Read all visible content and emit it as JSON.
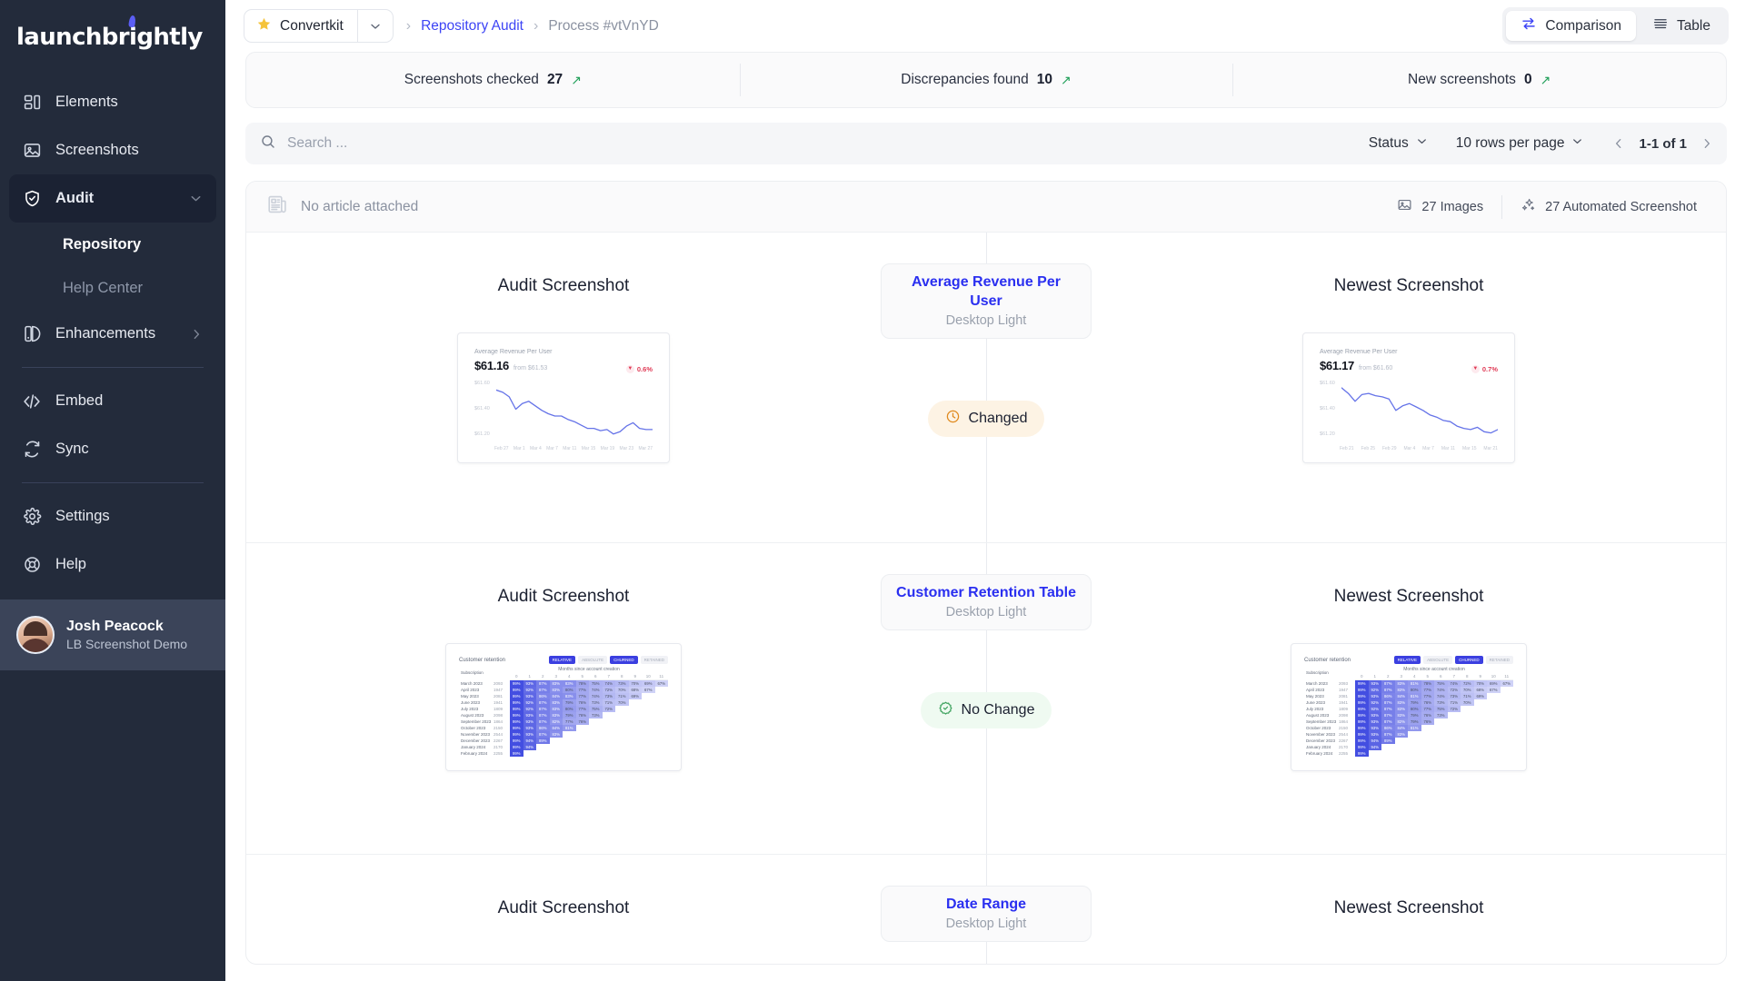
{
  "brand": {
    "logo_text": "launchbrightly",
    "accent": "#5b5ef4"
  },
  "sidebar": {
    "items": [
      {
        "label": "Elements",
        "icon": "elements-icon"
      },
      {
        "label": "Screenshots",
        "icon": "image-icon"
      },
      {
        "label": "Audit",
        "icon": "shield-check-icon",
        "active": true,
        "expanded": true
      },
      {
        "label": "Enhancements",
        "icon": "palette-icon"
      },
      {
        "label": "Embed",
        "icon": "code-icon"
      },
      {
        "label": "Sync",
        "icon": "refresh-icon"
      },
      {
        "label": "Settings",
        "icon": "gear-icon"
      }
    ],
    "sub_items": [
      {
        "label": "Repository",
        "active": true
      },
      {
        "label": "Help Center",
        "active": false
      }
    ],
    "help": {
      "label": "Help",
      "icon": "lifebuoy-icon"
    },
    "profile": {
      "name": "Josh Peacock",
      "org": "LB Screenshot Demo"
    }
  },
  "topbar": {
    "project": "Convertkit",
    "project_icon": "star-icon",
    "breadcrumb": [
      {
        "label": "Repository Audit",
        "type": "link"
      },
      {
        "label": "Process #vtVnYD",
        "type": "current"
      }
    ],
    "views": [
      {
        "label": "Comparison",
        "icon": "compare-arrows-icon",
        "active": true
      },
      {
        "label": "Table",
        "icon": "table-rows-icon",
        "active": false
      }
    ]
  },
  "stats": [
    {
      "label": "Screenshots checked",
      "value": "27",
      "trend": "↗"
    },
    {
      "label": "Discrepancies found",
      "value": "10",
      "trend": "↗"
    },
    {
      "label": "New screenshots",
      "value": "0",
      "trend": "↗"
    }
  ],
  "toolbar": {
    "search_placeholder": "Search ...",
    "search_value": "",
    "status_label": "Status",
    "rows_label": "10 rows per page",
    "page_label": "1-1 of 1"
  },
  "panel_head": {
    "article_text": "No article attached",
    "images_count": "27 Images",
    "automated_count": "27 Automated Screenshot"
  },
  "columns": {
    "left": "Audit Screenshot",
    "right": "Newest Screenshot"
  },
  "rows": [
    {
      "element": "Average Revenue Per User",
      "device": "Desktop Light",
      "status": "Changed",
      "status_type": "changed",
      "status_icon": "clock-icon"
    },
    {
      "element": "Customer Retention Table",
      "device": "Desktop Light",
      "status": "No Change",
      "status_type": "nochange",
      "status_icon": "check-badge-icon"
    },
    {
      "element": "Date Range",
      "device": "Desktop Light",
      "status": "",
      "status_type": "",
      "status_icon": ""
    }
  ],
  "chart_data": [
    {
      "type": "line",
      "id": "arpu-audit",
      "title": "Average Revenue Per User",
      "value": "$61.16",
      "from": "from $61.53",
      "delta": "0.6%",
      "delta_dir": "down",
      "ylabels": [
        "$61.60",
        "$61.40",
        "$61.20"
      ],
      "ylim": [
        61.1,
        61.68
      ],
      "xlabels": [
        "Feb 27",
        "Mar 1",
        "Mar 4",
        "Mar 7",
        "Mar 11",
        "Mar 15",
        "Mar 19",
        "Mar 23",
        "Mar 27"
      ],
      "values": [
        61.58,
        61.56,
        61.52,
        61.41,
        61.46,
        61.48,
        61.44,
        61.4,
        61.37,
        61.35,
        61.35,
        61.32,
        61.3,
        61.27,
        61.24,
        61.24,
        61.22,
        61.23,
        61.19,
        61.21,
        61.26,
        61.29,
        61.24,
        61.23,
        61.23
      ]
    },
    {
      "type": "line",
      "id": "arpu-newest",
      "title": "Average Revenue Per User",
      "value": "$61.17",
      "from": "from $61.60",
      "delta": "0.7%",
      "delta_dir": "down",
      "ylabels": [
        "$61.60",
        "$61.40",
        "$61.20"
      ],
      "ylim": [
        61.1,
        61.68
      ],
      "xlabels": [
        "Feb 21",
        "Feb 25",
        "Feb 29",
        "Mar 4",
        "Mar 7",
        "Mar 11",
        "Mar 15",
        "Mar 21"
      ],
      "values": [
        61.6,
        61.55,
        61.48,
        61.54,
        61.55,
        61.53,
        61.52,
        61.5,
        61.4,
        61.44,
        61.46,
        61.43,
        61.4,
        61.36,
        61.34,
        61.31,
        61.3,
        61.26,
        61.24,
        61.23,
        61.25,
        61.21,
        61.2,
        61.23
      ]
    },
    {
      "type": "heatmap",
      "id": "retention-audit",
      "title": "Customer retention",
      "col_label": "Months since account creation",
      "row_label": "Subscription",
      "toggles": [
        {
          "label": "RELATIVE",
          "on": true
        },
        {
          "label": "ABSOLUTE",
          "on": false
        },
        {
          "label": "CHURNED",
          "on": true
        },
        {
          "label": "RETAINED",
          "on": false
        }
      ],
      "months": [
        "0",
        "1",
        "2",
        "3",
        "4",
        "5",
        "6",
        "7",
        "8",
        "9",
        "10",
        "11"
      ],
      "cohorts": [
        {
          "label": "March 2023",
          "count": "2093",
          "values": [
            "99%",
            "93%",
            "87%",
            "83%",
            "83%",
            "78%",
            "75%",
            "74%",
            "73%",
            "70%",
            "69%",
            "67%"
          ]
        },
        {
          "label": "April 2023",
          "count": "1947",
          "values": [
            "99%",
            "92%",
            "87%",
            "83%",
            "80%",
            "77%",
            "74%",
            "72%",
            "70%",
            "68%",
            "67%"
          ]
        },
        {
          "label": "May 2023",
          "count": "2081",
          "values": [
            "99%",
            "93%",
            "86%",
            "84%",
            "83%",
            "77%",
            "74%",
            "73%",
            "71%",
            "69%"
          ]
        },
        {
          "label": "June 2023",
          "count": "1941",
          "values": [
            "99%",
            "92%",
            "87%",
            "83%",
            "79%",
            "76%",
            "73%",
            "71%",
            "70%"
          ]
        },
        {
          "label": "July 2023",
          "count": "1809",
          "values": [
            "99%",
            "92%",
            "87%",
            "83%",
            "80%",
            "77%",
            "75%",
            "72%"
          ]
        },
        {
          "label": "August 2023",
          "count": "2098",
          "values": [
            "99%",
            "93%",
            "87%",
            "83%",
            "79%",
            "76%",
            "73%"
          ]
        },
        {
          "label": "September 2023",
          "count": "1864",
          "values": [
            "99%",
            "93%",
            "87%",
            "82%",
            "77%",
            "76%"
          ]
        },
        {
          "label": "October 2023",
          "count": "2150",
          "values": [
            "99%",
            "93%",
            "86%",
            "84%",
            "81%"
          ]
        },
        {
          "label": "November 2023",
          "count": "2544",
          "values": [
            "99%",
            "93%",
            "87%",
            "83%"
          ]
        },
        {
          "label": "December 2023",
          "count": "2267",
          "values": [
            "99%",
            "94%",
            "89%"
          ]
        },
        {
          "label": "January 2024",
          "count": "2170",
          "values": [
            "99%",
            "94%"
          ]
        },
        {
          "label": "February 2024",
          "count": "2255",
          "values": [
            "99%"
          ]
        }
      ]
    },
    {
      "type": "heatmap",
      "id": "retention-newest",
      "title": "Customer retention",
      "col_label": "Months since account creation",
      "row_label": "Subscription",
      "toggles": [
        {
          "label": "RELATIVE",
          "on": true
        },
        {
          "label": "ABSOLUTE",
          "on": false
        },
        {
          "label": "CHURNED",
          "on": true
        },
        {
          "label": "RETAINED",
          "on": false
        }
      ],
      "months": [
        "0",
        "1",
        "2",
        "3",
        "4",
        "5",
        "6",
        "7",
        "8",
        "9",
        "10",
        "11"
      ],
      "cohorts": [
        {
          "label": "March 2023",
          "count": "2093",
          "values": [
            "99%",
            "93%",
            "87%",
            "83%",
            "81%",
            "78%",
            "75%",
            "74%",
            "72%",
            "70%",
            "69%",
            "67%"
          ]
        },
        {
          "label": "April 2023",
          "count": "1947",
          "values": [
            "99%",
            "92%",
            "87%",
            "83%",
            "80%",
            "77%",
            "74%",
            "72%",
            "70%",
            "68%",
            "67%"
          ]
        },
        {
          "label": "May 2023",
          "count": "2081",
          "values": [
            "99%",
            "93%",
            "86%",
            "84%",
            "81%",
            "77%",
            "74%",
            "73%",
            "71%",
            "69%"
          ]
        },
        {
          "label": "June 2023",
          "count": "1941",
          "values": [
            "99%",
            "92%",
            "87%",
            "83%",
            "79%",
            "76%",
            "73%",
            "71%",
            "70%"
          ]
        },
        {
          "label": "July 2023",
          "count": "1809",
          "values": [
            "99%",
            "92%",
            "87%",
            "83%",
            "80%",
            "77%",
            "75%",
            "72%"
          ]
        },
        {
          "label": "August 2023",
          "count": "2098",
          "values": [
            "99%",
            "93%",
            "87%",
            "83%",
            "79%",
            "76%",
            "73%"
          ]
        },
        {
          "label": "September 2023",
          "count": "1864",
          "values": [
            "99%",
            "93%",
            "87%",
            "82%",
            "79%",
            "76%"
          ]
        },
        {
          "label": "October 2023",
          "count": "2150",
          "values": [
            "99%",
            "93%",
            "86%",
            "84%",
            "81%"
          ]
        },
        {
          "label": "November 2023",
          "count": "2544",
          "values": [
            "99%",
            "93%",
            "87%",
            "83%"
          ]
        },
        {
          "label": "December 2023",
          "count": "2267",
          "values": [
            "99%",
            "94%",
            "89%"
          ]
        },
        {
          "label": "January 2024",
          "count": "2170",
          "values": [
            "99%",
            "94%"
          ]
        },
        {
          "label": "February 2024",
          "count": "2255",
          "values": [
            "99%"
          ]
        }
      ]
    }
  ]
}
